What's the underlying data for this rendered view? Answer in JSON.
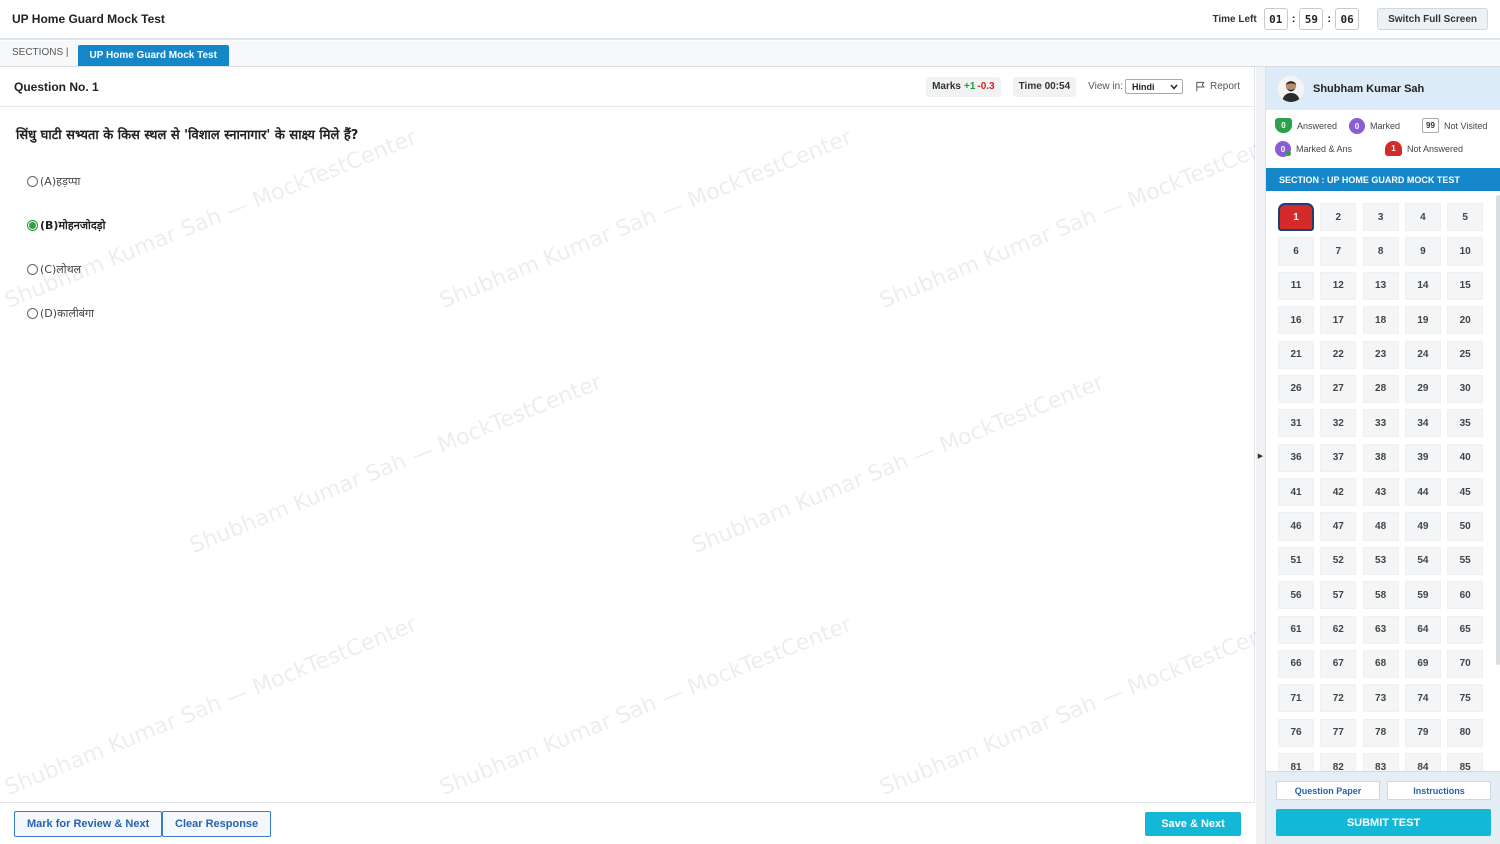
{
  "header": {
    "title": "UP Home Guard Mock Test",
    "time_left_label": "Time Left",
    "timer": {
      "hours": "01",
      "minutes": "59",
      "seconds": "06"
    },
    "fullscreen_label": "Switch Full Screen"
  },
  "sections": {
    "label": "SECTIONS |",
    "active_tab": "UP Home Guard Mock Test"
  },
  "question": {
    "number_label": "Question No. 1",
    "marks_label": "Marks",
    "marks_pos": "+1",
    "marks_neg": "-0.3",
    "time_label": "Time 00:54",
    "view_in_label": "View in:",
    "language": "Hindi",
    "report_label": "Report",
    "text": "सिंधु घाटी सभ्यता के किस स्थल से 'विशाल स्नानागार' के साक्ष्य मिले हैं?",
    "options": [
      {
        "key": "(A)",
        "text": "हड़प्पा",
        "selected": false
      },
      {
        "key": "(B)",
        "text": "मोहनजोदड़ो",
        "selected": true
      },
      {
        "key": "(C)",
        "text": "लोथल",
        "selected": false
      },
      {
        "key": "(D)",
        "text": "कालीबंगा",
        "selected": false
      }
    ]
  },
  "watermark_text": "Shubham Kumar Sah — MockTestCenter",
  "footer": {
    "mark_review_label": "Mark for Review & Next",
    "clear_label": "Clear Response",
    "save_next_label": "Save & Next"
  },
  "panel": {
    "user_name": "Shubham Kumar Sah",
    "legend": {
      "answered": {
        "count": "0",
        "label": "Answered"
      },
      "marked": {
        "count": "0",
        "label": "Marked"
      },
      "not_visited": {
        "count": "99",
        "label": "Not Visited"
      },
      "marked_ans": {
        "count": "0",
        "label": "Marked & Ans"
      },
      "not_answered": {
        "count": "1",
        "label": "Not Answered"
      }
    },
    "section_title": "SECTION : UP HOME GUARD MOCK TEST",
    "palette_count": 85,
    "current_question": 1,
    "question_paper_label": "Question Paper",
    "instructions_label": "Instructions",
    "submit_label": "SUBMIT TEST"
  },
  "colors": {
    "accent": "#1587c9",
    "submit": "#13b8d6",
    "answered": "#2aa14a",
    "marked": "#8a5cd6",
    "not_answered": "#d42a2a"
  }
}
